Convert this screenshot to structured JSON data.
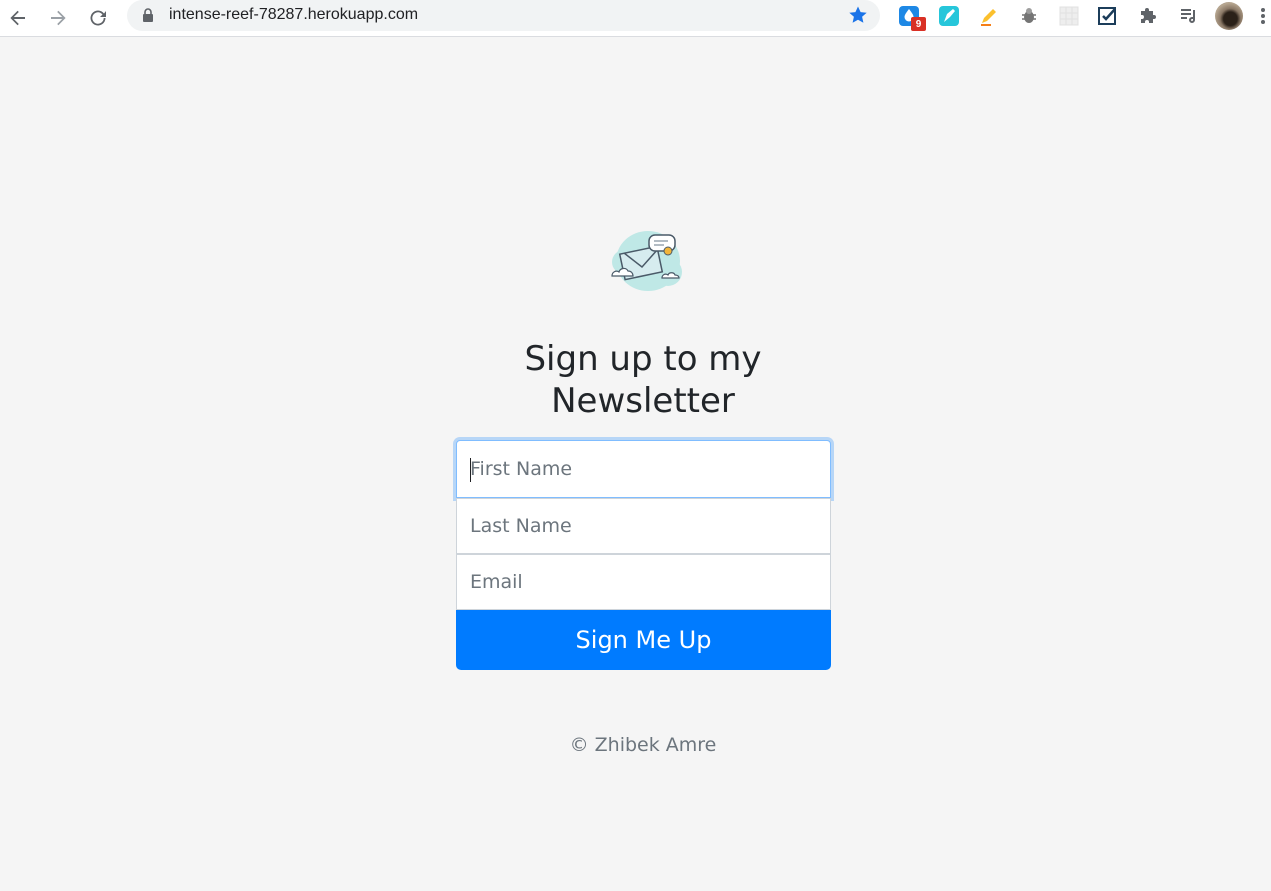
{
  "browser": {
    "url": "intense-reef-78287.herokuapp.com",
    "extension_badge": "9",
    "icons": [
      "back-icon",
      "forward-icon",
      "reload-icon",
      "lock-icon",
      "bookmark-star-icon",
      "extensions-puzzle-icon",
      "media-queue-icon",
      "menu-dots-icon"
    ]
  },
  "page": {
    "heading": "Sign up to my Newsletter",
    "form": {
      "first_name_placeholder": "First Name",
      "last_name_placeholder": "Last Name",
      "email_placeholder": "Email",
      "submit_label": "Sign Me Up"
    },
    "footer": "© Zhibek Amre"
  },
  "colors": {
    "accent": "#007bff",
    "background": "#f5f5f5",
    "focus_ring": "#80bdff"
  }
}
